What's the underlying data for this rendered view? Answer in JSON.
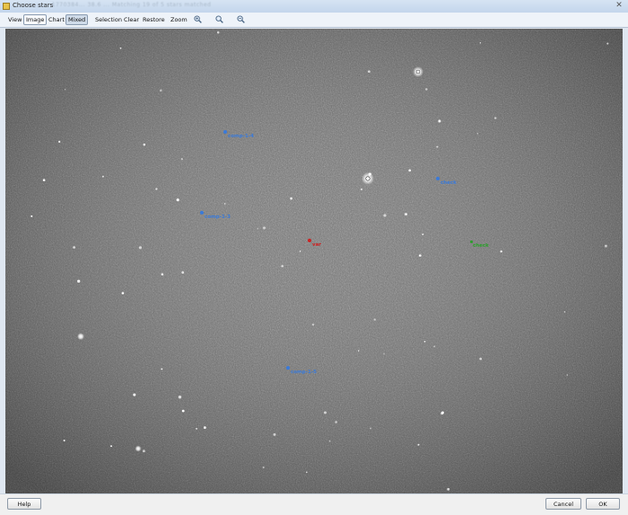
{
  "window": {
    "title": "Choose stars",
    "title_obscured": "... 1770384... 38.6 ... Matching 19 of 5 stars matched",
    "close_glyph": "✕"
  },
  "toolbar": {
    "view_label": "View",
    "image_label": "Image",
    "chart_label": "Chart",
    "mixed_label": "Mixed",
    "selection_label": "Selection",
    "clear_label": "Clear",
    "restore_label": "Restore",
    "zoom_label": "Zoom",
    "active_view": "Mixed",
    "zoom_icons": [
      "zoom-in-icon",
      "zoom-fit-icon",
      "zoom-out-icon"
    ]
  },
  "stars": [
    {
      "label": "comp-1-4",
      "role": "comparison",
      "color": "#3a7ad9"
    },
    {
      "label": "check",
      "role": "comparison",
      "color": "#3a7ad9"
    },
    {
      "label": "comp-1-3",
      "role": "comparison",
      "color": "#3a7ad9"
    },
    {
      "label": "var",
      "role": "variable",
      "color": "#cc2222"
    },
    {
      "label": "check",
      "role": "check",
      "color": "#2aa02a"
    },
    {
      "label": "comp-1-5",
      "role": "comparison",
      "color": "#3a7ad9"
    }
  ],
  "footer": {
    "help_label": "Help",
    "cancel_label": "Cancel",
    "ok_label": "OK"
  }
}
